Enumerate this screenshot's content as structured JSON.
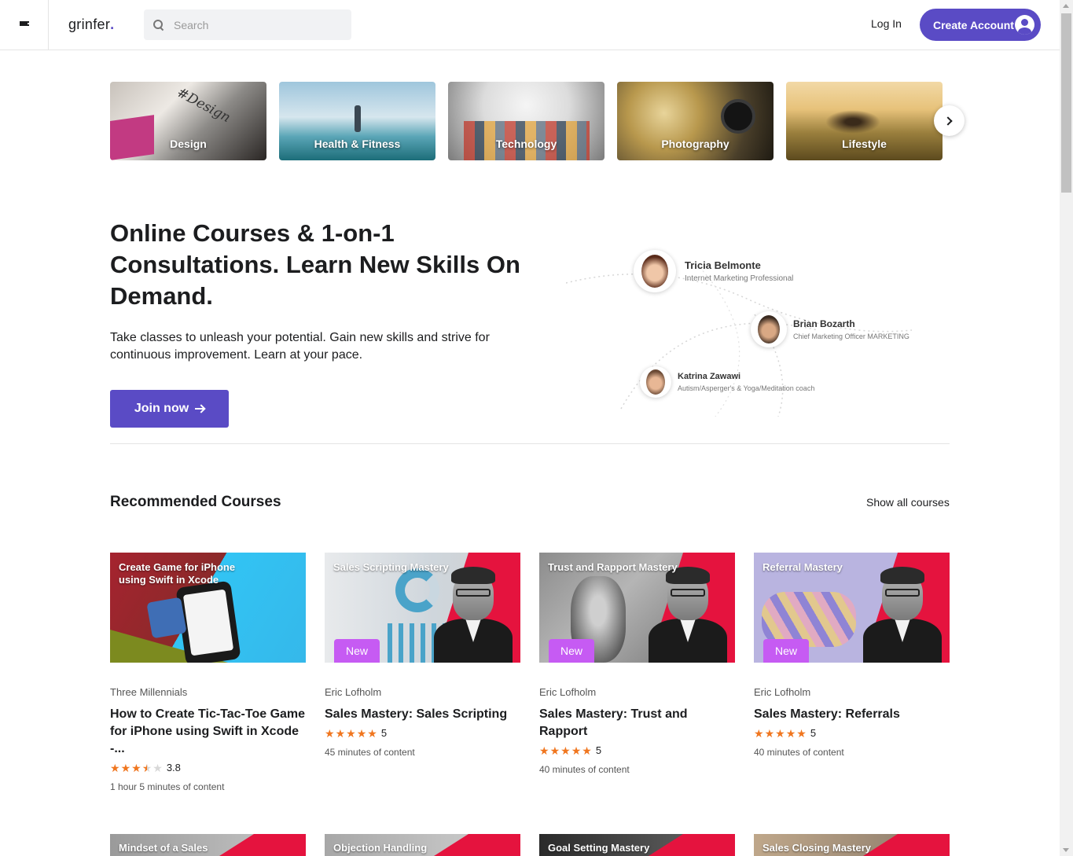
{
  "header": {
    "logo": "grinfer",
    "logo_dot": ".",
    "search_placeholder": "Search",
    "login_label": "Log In",
    "create_account_label": "Create Account"
  },
  "categories": [
    {
      "label": "Design"
    },
    {
      "label": "Health & Fitness"
    },
    {
      "label": "Technology"
    },
    {
      "label": "Photography"
    },
    {
      "label": "Lifestyle"
    }
  ],
  "hero": {
    "title": "Online Courses & 1-on-1 Consultations. Learn New Skills On Demand.",
    "subtitle": "Take classes to unleash your potential. Gain new skills and strive for continuous improvement. Learn at your pace.",
    "cta_label": "Join now",
    "people": [
      {
        "name": "Tricia Belmonte",
        "role": "Internet Marketing Professional"
      },
      {
        "name": "Brian Bozarth",
        "role": "Chief Marketing Officer MARKETING"
      },
      {
        "name": "Katrina Zawawi",
        "role": "Autism/Asperger's & Yoga/Meditation coach"
      }
    ]
  },
  "recommended": {
    "title": "Recommended Courses",
    "show_all_label": "Show all courses",
    "courses": [
      {
        "thumb_title": "Create Game for iPhone using Swift in Xcode",
        "badge": "",
        "author": "Three Millennials",
        "title": "How to Create Tic-Tac-Toe Game for iPhone using Swift in Xcode -...",
        "rating": "3.8",
        "duration": "1 hour 5 minutes of content"
      },
      {
        "thumb_title": "Sales Scripting Mastery",
        "badge": "New",
        "author": "Eric Lofholm",
        "title": "Sales Mastery: Sales Scripting",
        "rating": "5",
        "duration": "45 minutes of content"
      },
      {
        "thumb_title": "Trust and Rapport Mastery",
        "badge": "New",
        "author": "Eric Lofholm",
        "title": "Sales Mastery: Trust and Rapport",
        "rating": "5",
        "duration": "40 minutes of content"
      },
      {
        "thumb_title": "Referral Mastery",
        "badge": "New",
        "author": "Eric Lofholm",
        "title": "Sales Mastery: Referrals",
        "rating": "5",
        "duration": "40 minutes of content"
      }
    ],
    "next_row_thumbs": [
      {
        "thumb_title": "Mindset of a Sales"
      },
      {
        "thumb_title": "Objection Handling"
      },
      {
        "thumb_title": "Goal Setting Mastery"
      },
      {
        "thumb_title": "Sales Closing Mastery"
      }
    ]
  },
  "colors": {
    "brand": "#5a4bc5",
    "star": "#f0761f",
    "badge": "#c65bf3",
    "accent_red": "#e5133e"
  }
}
